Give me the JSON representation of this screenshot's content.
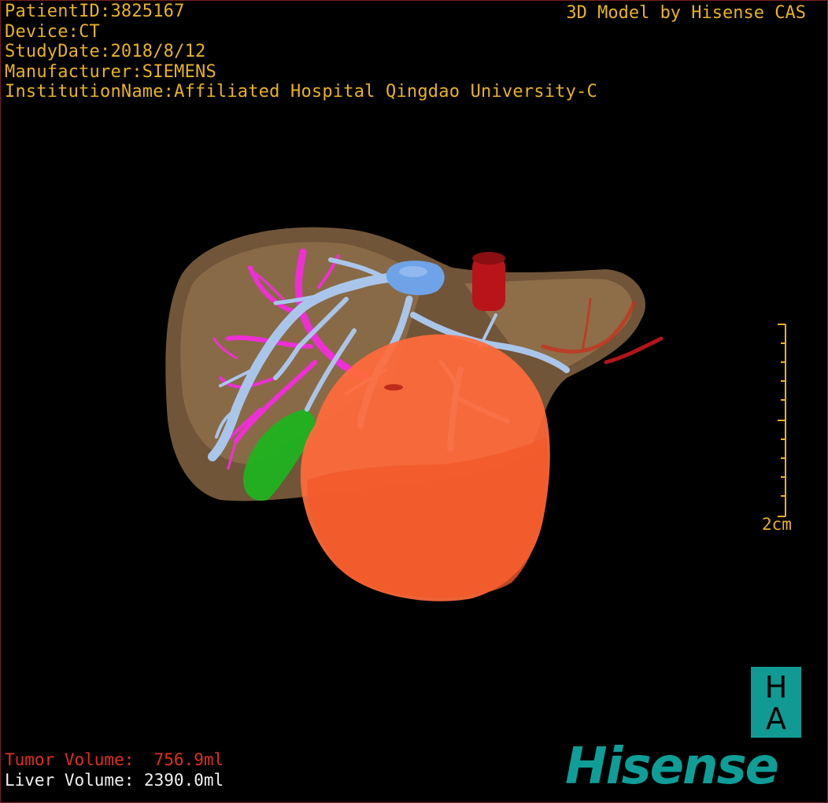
{
  "header": {
    "patient_id": "PatientID:3825167",
    "device": "Device:CT",
    "study_date": "StudyDate:2018/8/12",
    "manufacturer": "Manufacturer:SIEMENS",
    "institution": "InstitutionName:Affiliated Hospital Qingdao University-C",
    "brand_top": "3D Model by Hisense CAS"
  },
  "scale": {
    "label": "2cm"
  },
  "volumes": {
    "tumor": "Tumor Volume:  756.9ml",
    "liver": "Liver Volume: 2390.0ml"
  },
  "logo": {
    "letter_top": "H",
    "letter_bottom": "A",
    "wordmark": "Hisense"
  },
  "colors": {
    "overlay_text": "#e9b21f",
    "liver": "#a17d55",
    "tumor": "#ff6a3a",
    "portal_vein": "#a9c6ea",
    "hepatic_artery": "#ee2fd6",
    "gallbladder": "#19b81a",
    "ivc": "#c0161a",
    "brand": "#0f9d97"
  },
  "icons": {
    "scale_bar": "ruler-icon",
    "ha_logo": "ha-logo-icon"
  }
}
